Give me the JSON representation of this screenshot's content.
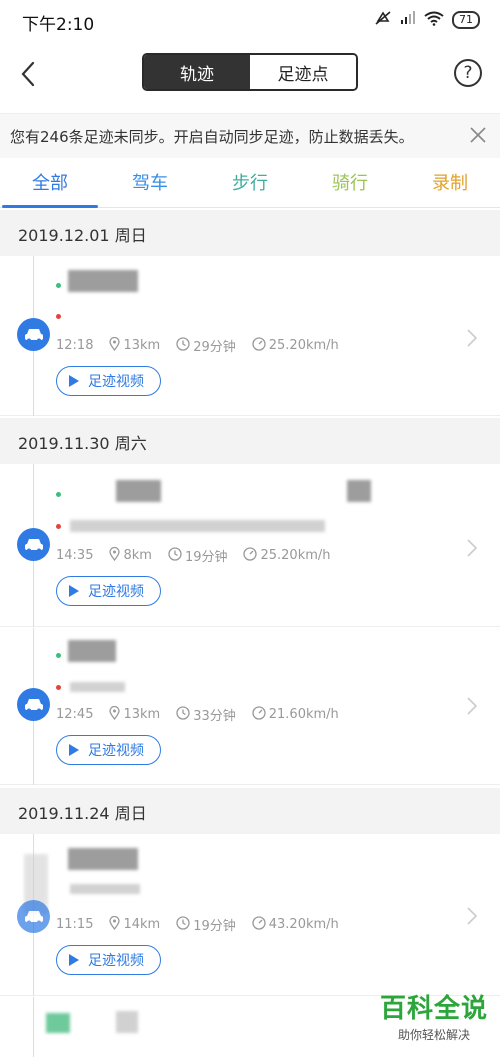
{
  "status_bar": {
    "time": "下午2:10",
    "battery": "71"
  },
  "nav": {
    "segments": [
      "轨迹",
      "足迹点"
    ],
    "active_segment": 0,
    "help": "?"
  },
  "sync_notice": {
    "text": "您有246条足迹未同步。开启自动同步足迹，防止数据丢失。"
  },
  "tabs": [
    {
      "label": "全部",
      "color": "#2f7be3",
      "active": true
    },
    {
      "label": "驾车",
      "color": "#3a8ee6",
      "active": false
    },
    {
      "label": "步行",
      "color": "#3fae9c",
      "active": false
    },
    {
      "label": "骑行",
      "color": "#9bc456",
      "active": false
    },
    {
      "label": "录制",
      "color": "#e2a12a",
      "active": false
    }
  ],
  "days": [
    {
      "date": "2019.12.01 周日",
      "trips": [
        {
          "time": "12:18",
          "distance": "13km",
          "duration": "29分钟",
          "speed": "25.20km/h",
          "video_label": "足迹视频"
        }
      ]
    },
    {
      "date": "2019.11.30 周六",
      "trips": [
        {
          "time": "14:35",
          "distance": "8km",
          "duration": "19分钟",
          "speed": "25.20km/h",
          "video_label": "足迹视频"
        },
        {
          "time": "12:45",
          "distance": "13km",
          "duration": "33分钟",
          "speed": "21.60km/h",
          "video_label": "足迹视频"
        }
      ]
    },
    {
      "date": "2019.11.24 周日",
      "trips": [
        {
          "time": "11:15",
          "distance": "14km",
          "duration": "19分钟",
          "speed": "43.20km/h",
          "video_label": "足迹视频"
        }
      ]
    }
  ],
  "watermark": {
    "title": "百科全说",
    "subtitle": "助你轻松解决"
  },
  "colors": {
    "accent": "#2f7be3",
    "start_dot": "#3bbf7a",
    "end_dot": "#e2453c"
  }
}
